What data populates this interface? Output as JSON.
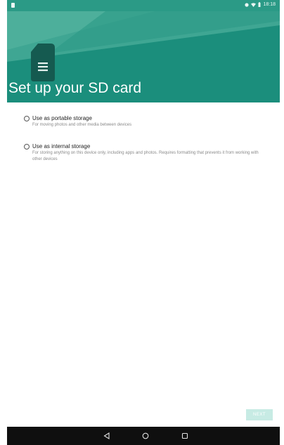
{
  "statusbar": {
    "time": "18:18"
  },
  "header": {
    "title": "Set up your SD card"
  },
  "options": [
    {
      "label": "Use as portable storage",
      "description": "For moving photos and other media between devices"
    },
    {
      "label": "Use as internal storage",
      "description": "For storing anything on this device only, including apps and photos. Requires formatting that prevents it from working with other devices"
    }
  ],
  "footer": {
    "next_label": "NEXT"
  },
  "navbar": {
    "back_icon": "back-icon",
    "home_icon": "home-icon",
    "recents_icon": "recents-icon"
  },
  "colors": {
    "header": "#1b8e7c",
    "header_light": "#2b9a86",
    "next_button": "#c7ebe4",
    "navbar": "#0f0f0f"
  }
}
